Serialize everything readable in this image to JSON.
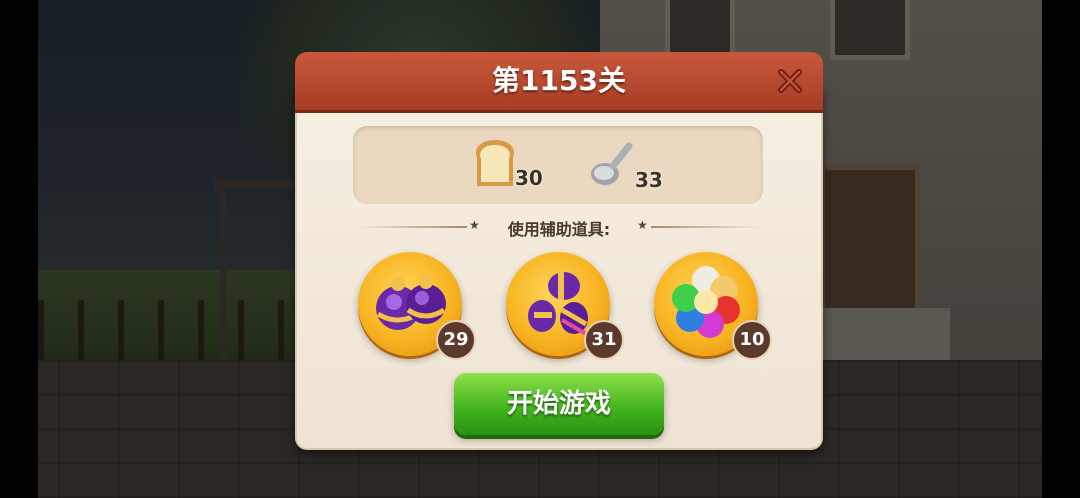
{
  "level": {
    "title": "第1153关"
  },
  "goals": [
    {
      "icon": "bread-icon",
      "count": "30"
    },
    {
      "icon": "spoon-icon",
      "count": "33"
    }
  ],
  "boosters": {
    "heading": "使用辅助道具:",
    "items": [
      {
        "icon": "purple-bomb-pair-icon",
        "count": "29"
      },
      {
        "icon": "striped-candy-icon",
        "count": "31"
      },
      {
        "icon": "color-ball-icon",
        "count": "10"
      }
    ]
  },
  "start_button": {
    "label": "开始游戏"
  },
  "colors": {
    "title_bar": "#b84a2f",
    "panel_bg": "#f3eadc",
    "start_button": "#4cbc22",
    "booster_gold": "#f7b421"
  }
}
